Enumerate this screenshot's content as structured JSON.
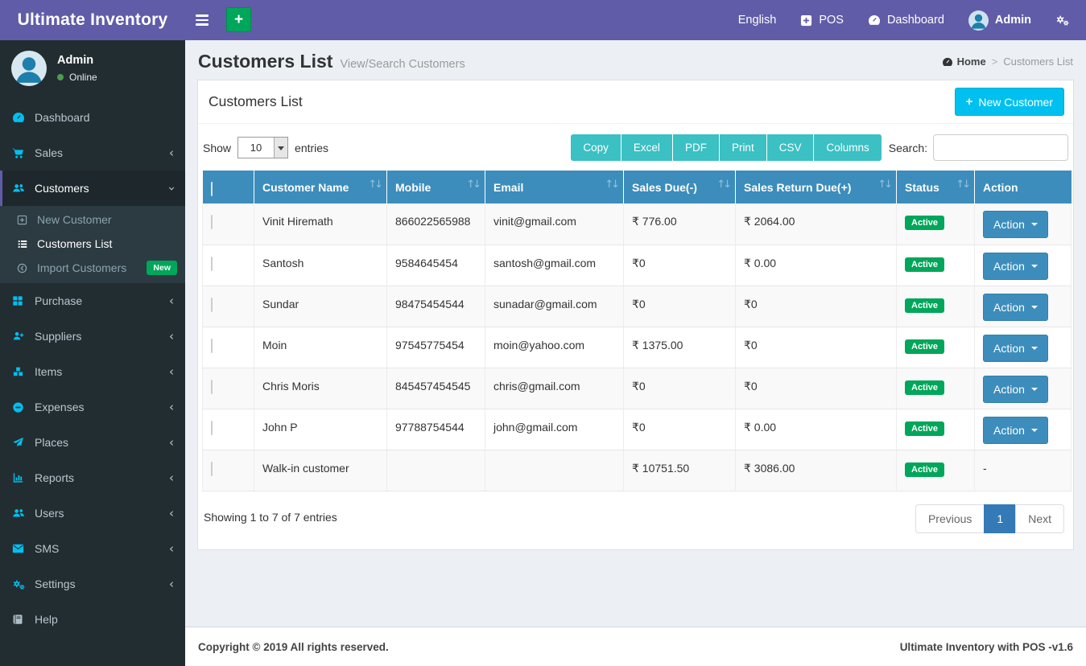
{
  "navbar": {
    "brand": "Ultimate Inventory",
    "language": "English",
    "pos_label": "POS",
    "dashboard_label": "Dashboard",
    "user_label": "Admin"
  },
  "sidebar": {
    "user": {
      "name": "Admin",
      "status": "Online"
    },
    "items": [
      {
        "label": "Dashboard"
      },
      {
        "label": "Sales"
      },
      {
        "label": "Customers"
      },
      {
        "label": "Purchase"
      },
      {
        "label": "Suppliers"
      },
      {
        "label": "Items"
      },
      {
        "label": "Expenses"
      },
      {
        "label": "Places"
      },
      {
        "label": "Reports"
      },
      {
        "label": "Users"
      },
      {
        "label": "SMS"
      },
      {
        "label": "Settings"
      },
      {
        "label": "Help"
      }
    ],
    "submenu": [
      {
        "label": "New Customer"
      },
      {
        "label": "Customers List"
      },
      {
        "label": "Import Customers",
        "badge": "New"
      }
    ]
  },
  "page": {
    "title": "Customers List",
    "subtitle": "View/Search Customers",
    "breadcrumb": {
      "home": "Home",
      "separator": ">",
      "current": "Customers List"
    }
  },
  "card": {
    "title": "Customers List",
    "new_button_label": "New Customer",
    "show_label": "Show",
    "page_length": "10",
    "entries_label": "entries",
    "export_buttons": [
      "Copy",
      "Excel",
      "PDF",
      "Print",
      "CSV",
      "Columns"
    ],
    "search_label": "Search:",
    "search_value": "",
    "info": "Showing 1 to 7 of 7 entries",
    "pagination": {
      "previous": "Previous",
      "page": "1",
      "next": "Next"
    }
  },
  "table": {
    "headers": [
      "Customer Name",
      "Mobile",
      "Email",
      "Sales Due(-)",
      "Sales Return Due(+)",
      "Status",
      "Action"
    ],
    "rows": [
      {
        "name": "Vinit Hiremath",
        "mobile": "866022565988",
        "email": "vinit@gmail.com",
        "sales_due": "₹ 776.00",
        "sales_return_due": "₹ 2064.00",
        "status": "Active",
        "action": "Action"
      },
      {
        "name": "Santosh",
        "mobile": "9584645454",
        "email": "santosh@gmail.com",
        "sales_due": "₹0",
        "sales_return_due": "₹ 0.00",
        "status": "Active",
        "action": "Action"
      },
      {
        "name": "Sundar",
        "mobile": "98475454544",
        "email": "sunadar@gmail.com",
        "sales_due": "₹0",
        "sales_return_due": "₹0",
        "status": "Active",
        "action": "Action"
      },
      {
        "name": "Moin",
        "mobile": "97545775454",
        "email": "moin@yahoo.com",
        "sales_due": "₹ 1375.00",
        "sales_return_due": "₹0",
        "status": "Active",
        "action": "Action"
      },
      {
        "name": "Chris Moris",
        "mobile": "845457454545",
        "email": "chris@gmail.com",
        "sales_due": "₹0",
        "sales_return_due": "₹0",
        "status": "Active",
        "action": "Action"
      },
      {
        "name": "John P",
        "mobile": "97788754544",
        "email": "john@gmail.com",
        "sales_due": "₹0",
        "sales_return_due": "₹ 0.00",
        "status": "Active",
        "action": "Action"
      },
      {
        "name": "Walk-in customer",
        "mobile": "",
        "email": "",
        "sales_due": "₹ 10751.50",
        "sales_return_due": "₹ 3086.00",
        "status": "Active",
        "action": "-"
      }
    ]
  },
  "footer": {
    "left": "Copyright © 2019 All rights reserved.",
    "right": "Ultimate Inventory with POS -v1.6"
  },
  "icons": {
    "plus": "+",
    "sort": "↑↓",
    "chevron": "‹"
  },
  "colors": {
    "navbar_purple": "#605ca8",
    "sidebar_dark": "#222d32",
    "submenu_dark": "#2c3b41",
    "icon_cyan": "#00c0ef",
    "table_header_blue": "#3c8dbc",
    "export_teal": "#3bc0c3",
    "new_button_cyan": "#00c0ef",
    "success_green": "#00a65a",
    "pagination_active_blue": "#337ab7",
    "content_bg": "#ecf0f5"
  }
}
